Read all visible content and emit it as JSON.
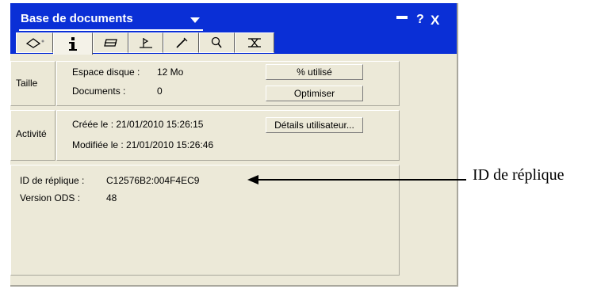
{
  "window": {
    "title": "Base de documents",
    "controls": {
      "help": "?",
      "close": "X"
    }
  },
  "tabs": [
    {
      "icon": "database-properties-icon"
    },
    {
      "icon": "info-icon",
      "active": true
    },
    {
      "icon": "print-icon"
    },
    {
      "icon": "design-icon"
    },
    {
      "icon": "advanced-icon"
    },
    {
      "icon": "search-icon"
    },
    {
      "icon": "security-icon"
    }
  ],
  "size_section": {
    "label": "Taille",
    "disk_space_label": "Espace disque :",
    "disk_space_value": "12 Mo",
    "documents_label": "Documents :",
    "documents_value": "0",
    "percent_used_button": "% utilisé",
    "optimize_button": "Optimiser"
  },
  "activity_section": {
    "label": "Activité",
    "created": "Créée le : 21/01/2010 15:26:15",
    "modified": "Modifiée le : 21/01/2010 15:26:46",
    "user_details_button": "Détails utilisateur..."
  },
  "replica_section": {
    "replica_id_label": "ID de réplique :",
    "replica_id_value": "C12576B2:004F4EC9",
    "ods_label": "Version ODS :",
    "ods_value": "48"
  },
  "annotation": {
    "text": "ID de réplique"
  }
}
